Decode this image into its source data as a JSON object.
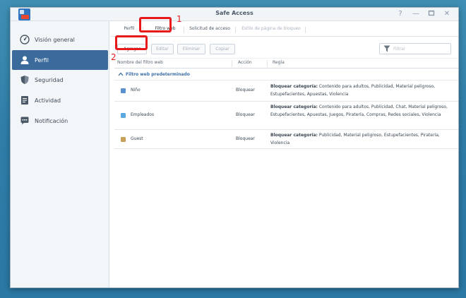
{
  "window": {
    "title": "Safe Access"
  },
  "colors": {
    "accent": "#3a6b9b",
    "annotation": "#e8191a",
    "desktop": "#3282ac"
  },
  "sidebar": {
    "items": [
      {
        "label": "Visión general",
        "icon": "dashboard-gauge-icon"
      },
      {
        "label": "Perfil",
        "icon": "user-profile-icon",
        "active": true
      },
      {
        "label": "Seguridad",
        "icon": "shield-icon"
      },
      {
        "label": "Actividad",
        "icon": "activity-log-icon"
      },
      {
        "label": "Notificación",
        "icon": "chat-bubble-icon"
      }
    ]
  },
  "tabs": [
    {
      "label": "Perfil"
    },
    {
      "label": "Filtro web",
      "active": true
    },
    {
      "label": "Solicitud de acceso"
    },
    {
      "label": "Estilo de página de bloqueo",
      "disabled": true
    }
  ],
  "toolbar": {
    "add_label": "Agregar",
    "edit_label": "Editar",
    "delete_label": "Eliminar",
    "copy_label": "Copiar",
    "filter_placeholder": "Filtrar"
  },
  "grid": {
    "headers": {
      "name": "Nombre del filtro web",
      "action": "Acción",
      "rule": "Regla"
    },
    "group_label": "Filtro web predeterminado",
    "rows": [
      {
        "name": "Niño",
        "action": "Bloquear",
        "rule_prefix": "Bloquear categoría:",
        "rule_text": "Contenido para adultos, Publicidad, Material peligroso, Estupefacientes, Apuestas, Violencia",
        "icon_color": "#5b8fd0"
      },
      {
        "name": "Empleados",
        "action": "Bloquear",
        "rule_prefix": "Bloquear categoría:",
        "rule_text": "Contenido para adultos, Publicidad, Chat, Material peligroso, Estupefacientes, Apuestas, Juegos, Piratería, Compras, Redes sociales, Violencia",
        "icon_color": "#5aa8e0"
      },
      {
        "name": "Guest",
        "action": "Bloquear",
        "rule_prefix": "Bloquear categoría:",
        "rule_text": "Publicidad, Material peligroso, Estupefacientes, Piratería, Violencia",
        "icon_color": "#c7a15a"
      }
    ]
  },
  "annotations": {
    "step1": "1",
    "step2": "2"
  }
}
